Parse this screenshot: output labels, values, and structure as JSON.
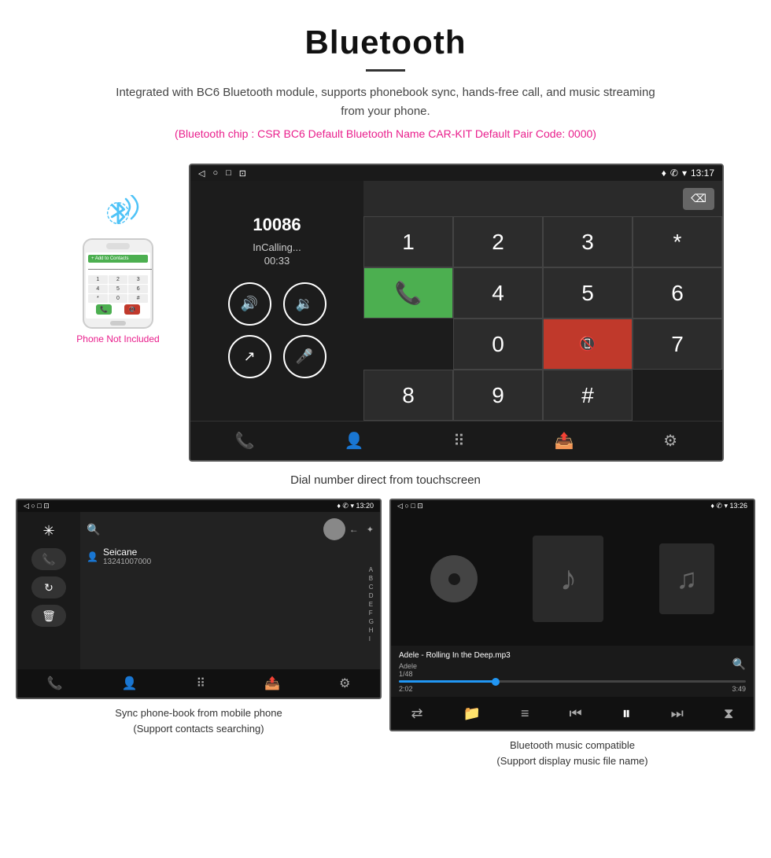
{
  "header": {
    "title": "Bluetooth",
    "description": "Integrated with BC6 Bluetooth module, supports phonebook sync, hands-free call, and music streaming from your phone.",
    "specs": "(Bluetooth chip : CSR BC6    Default Bluetooth Name CAR-KIT    Default Pair Code: 0000)"
  },
  "car_screen": {
    "status_bar": {
      "left": [
        "◁",
        "○",
        "□",
        "⊡"
      ],
      "right_icons": "♦ ✆ ▾",
      "time": "13:17"
    },
    "dial": {
      "number": "10086",
      "status": "InCalling...",
      "timer": "00:33"
    },
    "keypad": [
      [
        "1",
        "2",
        "3",
        "*"
      ],
      [
        "4",
        "5",
        "6",
        "0"
      ],
      [
        "7",
        "8",
        "9",
        "#"
      ]
    ],
    "caption": "Dial number direct from touchscreen"
  },
  "phonebook_screen": {
    "status_time": "13:20",
    "contact_name": "Seicane",
    "contact_number": "13241007000",
    "alphabet": [
      "A",
      "B",
      "C",
      "D",
      "E",
      "F",
      "G",
      "H",
      "I"
    ],
    "caption_line1": "Sync phone-book from mobile phone",
    "caption_line2": "(Support contacts searching)"
  },
  "music_screen": {
    "status_time": "13:26",
    "song": "Adele - Rolling In the Deep.mp3",
    "artist": "Adele",
    "track_info": "1/48",
    "time_current": "2:02",
    "time_total": "3:49",
    "caption_line1": "Bluetooth music compatible",
    "caption_line2": "(Support display music file name)"
  },
  "phone_mock": {
    "not_included": "Phone Not Included",
    "add_contacts": "+ Add to Contacts",
    "keys": [
      "1",
      "2",
      "3",
      "4",
      "5",
      "6",
      "*",
      "0",
      "#"
    ]
  }
}
